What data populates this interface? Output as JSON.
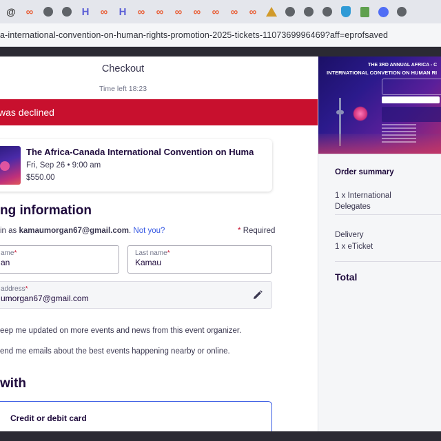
{
  "browser": {
    "url": "a-international-convention-on-human-rights-promotion-2025-tickets-1107369996469?aff=eprofsaved"
  },
  "checkout": {
    "title": "Checkout",
    "timer": "Time left 18:23",
    "declined_text": "was declined"
  },
  "event": {
    "name": "The Africa-Canada International Convention on Human…",
    "date": "Fri, Sep 26 • 9:00 am",
    "price": "$550.00"
  },
  "billing": {
    "heading": "ng information",
    "logged_prefix": "in as ",
    "logged_email": "kamaumorgan67@gmail.com",
    "logged_period": ".",
    "not_you": "Not you?",
    "required_star": "*",
    "required_label": "Required",
    "first_name_label": "ame",
    "first_name_value": "an",
    "last_name_label": "Last name",
    "last_name_value": "Kamau",
    "email_label": "address",
    "email_value": "umorgan67@gmail.com",
    "field_star": "*",
    "option_updates": "eep me updated on more events and news from this event organizer.",
    "option_emails": "end me emails about the best events happening nearby or online."
  },
  "payment": {
    "heading": "with",
    "card_label": "Credit or debit card"
  },
  "banner": {
    "top_text": "THE 3RD ANNUAL AFRICA - C",
    "main_text": "INTERNATIONAL CONVETION ON HUMAN RI"
  },
  "order_summary": {
    "title": "Order summary",
    "item": "1 x International Delegates",
    "delivery_title": "Delivery",
    "delivery_item": "1 x eTicket",
    "total": "Total"
  },
  "icons": {
    "favicons": [
      "at-icon",
      "link-icon",
      "globe-icon",
      "globe-icon",
      "h-icon",
      "link-icon",
      "h-icon",
      "link-icon",
      "link-icon",
      "link-icon",
      "link-icon",
      "link-icon",
      "link-icon",
      "link-icon",
      "triangle-icon",
      "globe-icon",
      "globe-icon",
      "globe-icon",
      "shield-icon",
      "bag-icon",
      "circle-icon",
      "globe-icon"
    ]
  },
  "colors": {
    "declined_banner": "#c8102e",
    "link": "#3659e3",
    "heading": "#1e0a3c"
  }
}
